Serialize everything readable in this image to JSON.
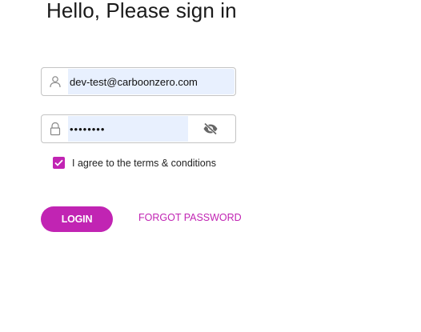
{
  "page": {
    "title": "Hello, Please sign in"
  },
  "email": {
    "value": "dev-test@carboonzero.com",
    "icon": "user-icon"
  },
  "password": {
    "value": "********",
    "icon": "lock-icon",
    "toggle_icon": "eye-off-icon"
  },
  "agree": {
    "checked": true,
    "label": "I agree to the terms & conditions"
  },
  "actions": {
    "login_label": "LOGIN",
    "forgot_label": "FORGOT PASSWORD"
  },
  "colors": {
    "accent": "#c124b3",
    "autofill": "#e8f0fe",
    "border": "#c4c4c4",
    "icon": "#888888"
  }
}
